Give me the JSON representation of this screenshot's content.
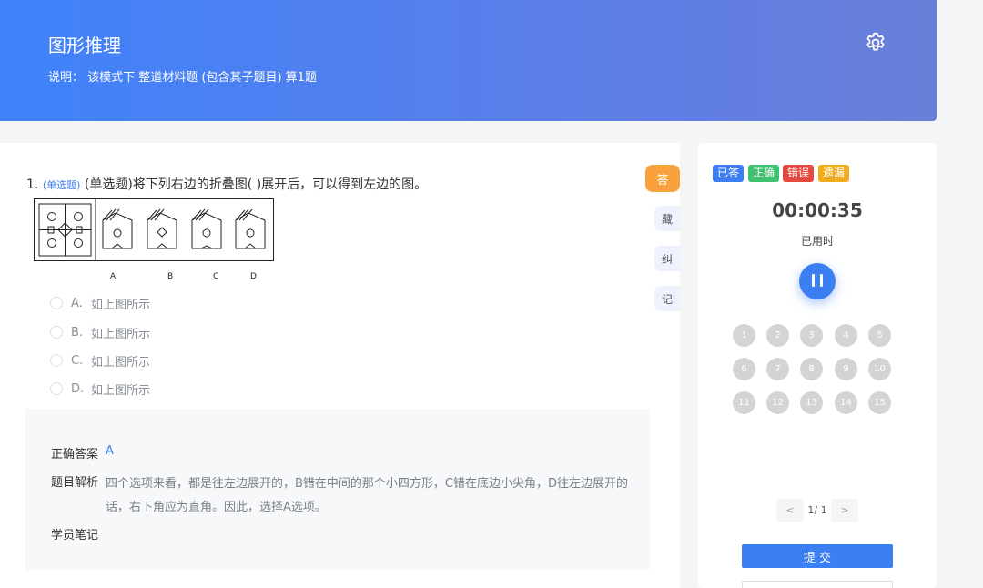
{
  "header": {
    "title": "图形推理",
    "description": "说明：  该模式下 整道材料题 (包含其子题目) 算1题"
  },
  "question": {
    "number": "1.",
    "type_tag": "(单选题)",
    "stem": "(单选题)将下列右边的折叠图(        )展开后，可以得到左边的图。",
    "figure_labels": [
      "A",
      "B",
      "C",
      "D"
    ],
    "options": [
      {
        "letter": "A.",
        "text": "如上图所示"
      },
      {
        "letter": "B.",
        "text": "如上图所示"
      },
      {
        "letter": "C.",
        "text": "如上图所示"
      },
      {
        "letter": "D.",
        "text": "如上图所示"
      }
    ]
  },
  "analysis": {
    "answer_label": "正确答案",
    "answer_value": "A",
    "explain_label": "题目解析",
    "explain_text": "四个选项来看，都是往左边展开的，B错在中间的那个小四方形，C错在底边小尖角，D往左边展开的话，右下角应为直角。因此，选择A选项。",
    "notes_label": "学员笔记"
  },
  "side_tabs": [
    "答",
    "藏",
    "纠",
    "记"
  ],
  "panel": {
    "legend": [
      {
        "label": "已答",
        "color": "#3b7ff3"
      },
      {
        "label": "正确",
        "color": "#3fc26f"
      },
      {
        "label": "错误",
        "color": "#e44a3f"
      },
      {
        "label": "遗漏",
        "color": "#f0ac1c"
      }
    ],
    "timer": "00:00:35",
    "timer_label": "已用时",
    "numbers": [
      "1",
      "2",
      "3",
      "4",
      "5",
      "6",
      "7",
      "8",
      "9",
      "10",
      "11",
      "12",
      "13",
      "14",
      "15"
    ],
    "pager": {
      "prev": "<",
      "current": "1/ 1",
      "next": ">"
    },
    "submit_label": "提 交"
  },
  "colors": {
    "accent": "#3b7ff3",
    "header_start": "#3f82fa",
    "header_end": "#6a7fd8",
    "answer_tab": "#f9a23d"
  },
  "icons": {
    "settings": "gear-icon",
    "pause": "pause-icon"
  }
}
